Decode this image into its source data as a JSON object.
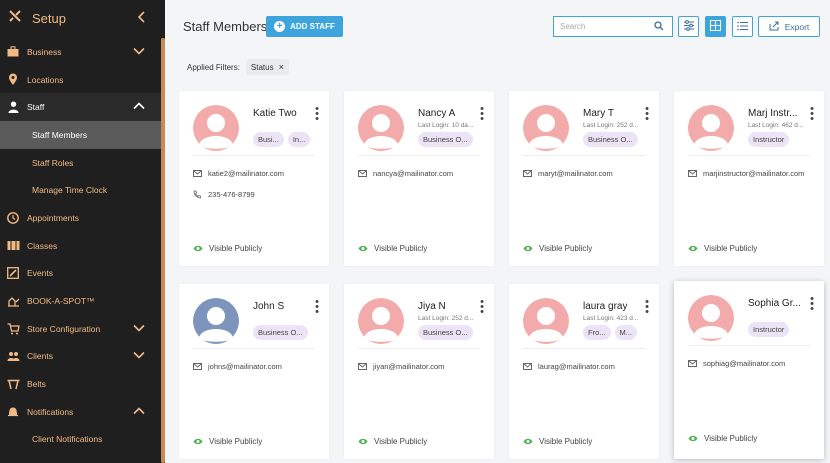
{
  "sidebar": {
    "title": "Setup",
    "items": [
      {
        "label": "Business",
        "icon": "briefcase-icon",
        "chevron": "down"
      },
      {
        "label": "Locations",
        "icon": "map-pin-icon"
      },
      {
        "label": "Staff",
        "icon": "person-icon",
        "chevron": "up"
      },
      {
        "label": "Staff Members",
        "sub": true
      },
      {
        "label": "Staff Roles",
        "sub": true
      },
      {
        "label": "Manage Time Clock",
        "sub": true
      },
      {
        "label": "Appointments",
        "icon": "clock-icon"
      },
      {
        "label": "Classes",
        "icon": "classes-icon"
      },
      {
        "label": "Events",
        "icon": "edit-icon"
      },
      {
        "label": "BOOK-A-SPOT™",
        "icon": "book-a-spot-icon"
      },
      {
        "label": "Store Configuration",
        "icon": "cart-icon",
        "chevron": "down"
      },
      {
        "label": "Clients",
        "icon": "clients-icon",
        "chevron": "down"
      },
      {
        "label": "Belts",
        "icon": "belt-icon"
      },
      {
        "label": "Notifications",
        "icon": "bell-icon",
        "chevron": "up"
      },
      {
        "label": "Client Notifications",
        "sub": true
      }
    ]
  },
  "header": {
    "title": "Staff Members",
    "add_label": "ADD STAFF",
    "search_placeholder": "Search",
    "export_label": "Export"
  },
  "filters": {
    "label": "Applied Filters:",
    "chips": [
      "Status"
    ]
  },
  "visible_label": "Visible Publicly",
  "staff": [
    {
      "name": "Katie Two",
      "last_login": "",
      "badges": [
        "Busi...",
        "In..."
      ],
      "email": "katie2@mailinator.com",
      "phone": "235-476-8799",
      "avatar": "pink"
    },
    {
      "name": "Nancy A",
      "last_login": "Last Login: 10 da...",
      "badges": [
        "Business O..."
      ],
      "email": "nancya@mailinator.com",
      "phone": "",
      "avatar": "pink"
    },
    {
      "name": "Mary T",
      "last_login": "Last Login: 252 d...",
      "badges": [
        "Business O..."
      ],
      "email": "maryt@mailinator.com",
      "phone": "",
      "avatar": "pink"
    },
    {
      "name": "Marj Instr...",
      "last_login": "Last Login: 462 d...",
      "badges": [
        "Instructor"
      ],
      "email": "marjinstructor@mailinator.com",
      "phone": "",
      "avatar": "pink"
    },
    {
      "name": "John S",
      "last_login": "",
      "badges": [
        "Business O..."
      ],
      "email": "johns@mailinator.com",
      "phone": "",
      "avatar": "blue"
    },
    {
      "name": "Jiya N",
      "last_login": "Last Login: 252 d...",
      "badges": [
        "Business O..."
      ],
      "email": "jiyan@mailinator.com",
      "phone": "",
      "avatar": "pink"
    },
    {
      "name": "laura gray",
      "last_login": "Last Login: 423 d...",
      "badges": [
        "Fro...",
        "M..."
      ],
      "email": "laurag@mailinator.com",
      "phone": "",
      "avatar": "pink"
    },
    {
      "name": "Sophia Gr...",
      "last_login": "",
      "badges": [
        "Instructor"
      ],
      "email": "sophiag@mailinator.com",
      "phone": "",
      "avatar": "pink",
      "highlight": true
    }
  ],
  "colors": {
    "sidebar_bg": "#1f1f1f",
    "sidebar_text": "#f2b983",
    "accent": "#3da4dc",
    "badge_bg": "#ece4f6",
    "visible_icon": "#4caf50"
  }
}
